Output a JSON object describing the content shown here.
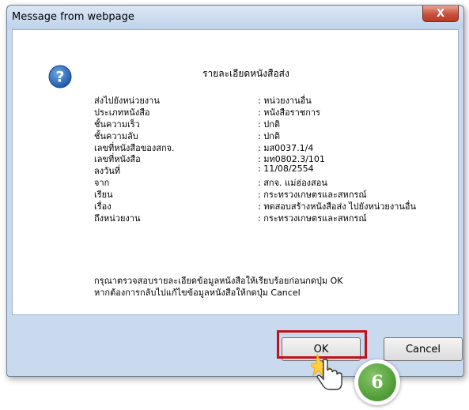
{
  "dialog": {
    "title": "Message from webpage",
    "close_label": "X",
    "heading": "รายละเอียดหนังสือส่ง",
    "rows": [
      {
        "label": "ส่งไปยังหน่วยงาน",
        "value": ": หน่วยงานอื่น"
      },
      {
        "label": "ประเภทหนังสือ",
        "value": ": หนังสือราชการ"
      },
      {
        "label": "ชั้นความเร็ว",
        "value": ": ปกติ"
      },
      {
        "label": "ชั้นความลับ",
        "value": ": ปกติ"
      },
      {
        "label": "เลขที่หนังสือของสกจ.",
        "value": ": มส0037.1/4"
      },
      {
        "label": "เลขที่หนังสือ",
        "value": ": มท0802.3/101"
      },
      {
        "label": "ลงวันที่",
        "value": ": 11/08/2554"
      },
      {
        "label": "จาก",
        "value": ": สกจ. แม่ฮ่องสอน"
      },
      {
        "label": "เรียน",
        "value": ": กระทรวงเกษตรและสหกรณ์"
      },
      {
        "label": "เรื่อง",
        "value": ": ทดสอบสร้างหนังสือส่ง ไปยังหน่วยงานอื่น"
      },
      {
        "label": "ถึงหน่วยงาน",
        "value": ": กระทรวงเกษตรและสหกรณ์"
      }
    ],
    "note_line1": "กรุณาตรวจสอบรายละเอียดข้อมูลหนังสือให้เรียบร้อยก่อนกดปุ่ม OK",
    "note_line2": "หากต้องการกลับไปแก้ไขข้อมูลหนังสือให้กดปุ่ม Cancel",
    "ok_label": "OK",
    "cancel_label": "Cancel"
  },
  "step_badge": "6",
  "colors": {
    "highlight": "#c0121b",
    "badge": "#4e9a35",
    "icon": "#1e5aa8"
  },
  "icons": [
    "question-icon",
    "close-icon",
    "hand-cursor-icon"
  ]
}
